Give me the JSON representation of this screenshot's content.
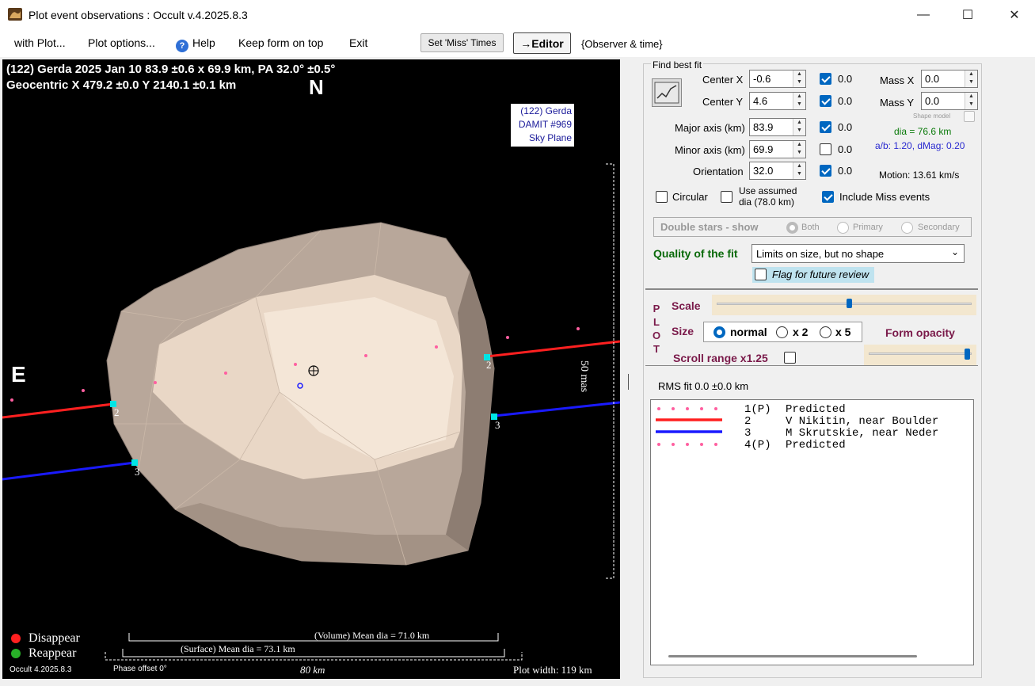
{
  "window": {
    "title": "Plot event observations : Occult v.4.2025.8.3"
  },
  "menu": {
    "with_plot": "with Plot...",
    "plot_options": "Plot options...",
    "help": "Help",
    "keep_on_top": "Keep form on top",
    "exit": "Exit",
    "set_miss_times": "Set 'Miss' Times",
    "editor": "→Editor",
    "observer_time": "{Observer & time}"
  },
  "plot": {
    "header_line1": "(122) Gerda  2025 Jan 10   83.9 ±0.6 x 69.9 km,  PA 32.0° ±0.5°",
    "header_line2": "Geocentric  X  479.2 ±0.0  Y 2140.1 ±0.1 km",
    "north": "N",
    "east": "E",
    "model_label": [
      "(122) Gerda",
      "DAMIT #969",
      "Sky Plane"
    ],
    "scale_mas": "50 mas",
    "chord_labels": [
      "2",
      "2",
      "3",
      "3"
    ],
    "legend_disappear": "Disappear",
    "legend_reappear": "Reappear",
    "volume_dia": "(Volume) Mean dia = 71.0 km",
    "surface_dia": "(Surface) Mean dia = 73.1 km",
    "version": "Occult 4.2025.8.3",
    "phase_offset": "Phase offset 0°",
    "scale_km": "80 km",
    "plot_width": "Plot width: 119 km",
    "colors": {
      "disappear": "#ff2020",
      "reappear": "#28b028",
      "chord_red": "#ff2020",
      "chord_blue": "#1a1aff",
      "predicted": "#ff5fa0",
      "marker": "#00e5e5"
    }
  },
  "fit": {
    "title": "Find best fit",
    "center_x_label": "Center X",
    "center_x": "-0.6",
    "center_x_res": "0.0",
    "center_y_label": "Center Y",
    "center_y": "4.6",
    "center_y_res": "0.0",
    "major_label": "Major axis (km)",
    "major": "83.9",
    "major_res": "0.0",
    "minor_label": "Minor axis (km)",
    "minor": "69.9",
    "minor_res": "0.0",
    "orient_label": "Orientation",
    "orient": "32.0",
    "orient_res": "0.0",
    "mass_x_label": "Mass X",
    "mass_x": "0.0",
    "mass_y_label": "Mass Y",
    "mass_y": "0.0",
    "shape_model": "Shape model",
    "dia": "dia = 76.6 km",
    "ab_dmag": "a/b: 1.20, dMag: 0.20",
    "motion": "Motion: 13.61 km/s",
    "circular": "Circular",
    "use_assumed_1": "Use assumed",
    "use_assumed_2": "dia (78.0 km)",
    "include_miss": "Include Miss events",
    "double_stars": "Double stars - show",
    "both": "Both",
    "primary": "Primary",
    "secondary": "Secondary",
    "quality_label": "Quality of the fit",
    "quality_value": "Limits on size, but no shape",
    "flag_review": "Flag for future review"
  },
  "plot_ctrl": {
    "plot_letters": [
      "P",
      "L",
      "O",
      "T"
    ],
    "scale": "Scale",
    "size": "Size",
    "normal": "normal",
    "x2": "x 2",
    "x5": "x 5",
    "form_opacity": "Form opacity",
    "scroll_range": "Scroll range x1.25",
    "rms_fit": "RMS fit 0.0 ±0.0 km",
    "scale_level": 0.52,
    "opacity_level": 0.95
  },
  "legend": [
    {
      "num": "1(P)",
      "name": "Predicted"
    },
    {
      "num": "2",
      "name": "V Nikitin, near Boulder"
    },
    {
      "num": "3",
      "name": "M Skrutskie, near Neder"
    },
    {
      "num": "4(P)",
      "name": "Predicted"
    }
  ]
}
